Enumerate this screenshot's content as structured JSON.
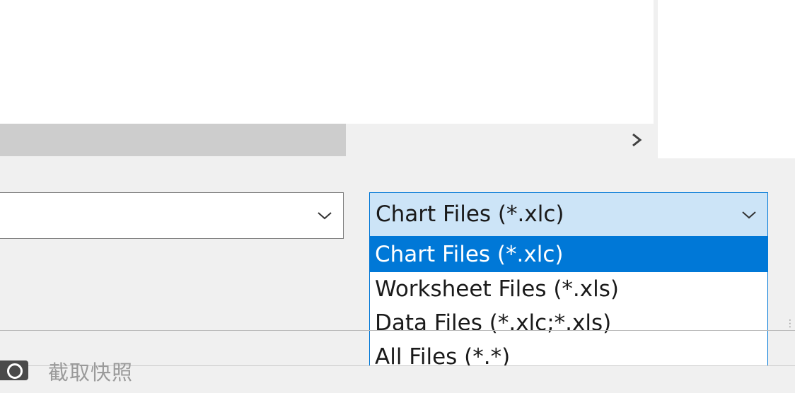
{
  "file_type_combo": {
    "selected_value": "Chart Files (*.xlc)"
  },
  "file_type_options": [
    {
      "label": "Chart Files (*.xlc)",
      "selected": true
    },
    {
      "label": "Worksheet Files (*.xls)",
      "selected": false
    },
    {
      "label": "Data Files (*.xlc;*.xls)",
      "selected": false
    },
    {
      "label": "All Files (*.*)",
      "selected": false
    }
  ],
  "bottom_bar": {
    "label": "截取快照"
  },
  "icons": {
    "scroll_right": "chevron-right-icon",
    "combo_dropdown": "chevron-down-icon",
    "camera": "camera-icon",
    "grip": "resize-grip-icon"
  },
  "colors": {
    "accent": "#0078d7",
    "combo_focus_bg": "#cce4f7",
    "window_bg": "#f0f0f0",
    "scroll_thumb": "#cdcdcd"
  }
}
